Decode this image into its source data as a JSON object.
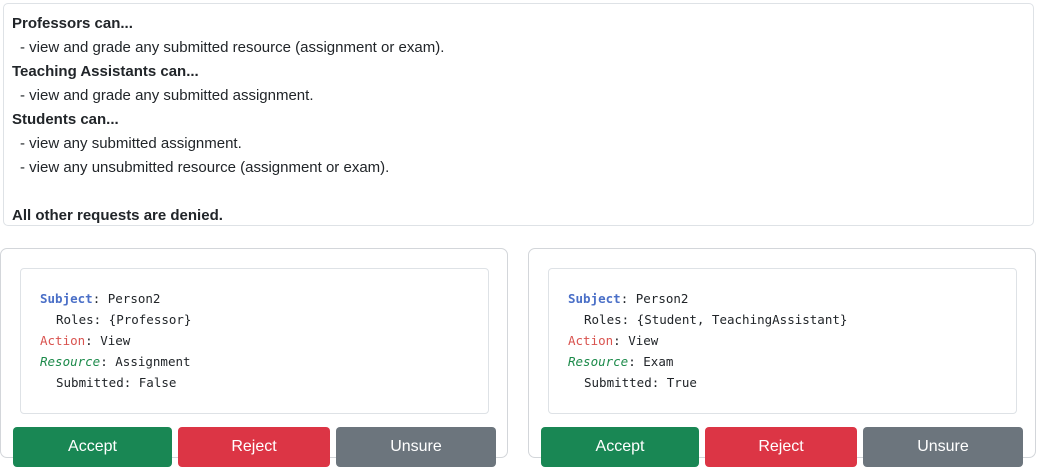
{
  "rules": {
    "professors_heading": "Professors can...",
    "professors_items": [
      "- view and grade any submitted resource (assignment or exam)."
    ],
    "tas_heading": "Teaching Assistants can...",
    "tas_items": [
      "- view and grade any submitted assignment."
    ],
    "students_heading": "Students can...",
    "students_items": [
      "- view any submitted assignment.",
      "- view any unsubmitted resource (assignment or exam)."
    ],
    "footer": "All other requests are denied."
  },
  "requests": [
    {
      "subject_key": "Subject",
      "subject_value": ": Person2",
      "roles_line": "Roles: {Professor}",
      "action_key": "Action",
      "action_value": ": View",
      "resource_key": "Resource",
      "resource_value": ": Assignment",
      "submitted_line": "Submitted: False",
      "buttons": {
        "accept": "Accept",
        "reject": "Reject",
        "unsure": "Unsure"
      }
    },
    {
      "subject_key": "Subject",
      "subject_value": ": Person2",
      "roles_line": "Roles: {Student, TeachingAssistant}",
      "action_key": "Action",
      "action_value": ": View",
      "resource_key": "Resource",
      "resource_value": ": Exam",
      "submitted_line": "Submitted: True",
      "buttons": {
        "accept": "Accept",
        "reject": "Reject",
        "unsure": "Unsure"
      }
    }
  ],
  "colors": {
    "subject": "#4a6fc7",
    "action": "#d9534f",
    "resource": "#1c8a4a",
    "accept": "#198754",
    "reject": "#dc3545",
    "unsure": "#6c757d"
  }
}
